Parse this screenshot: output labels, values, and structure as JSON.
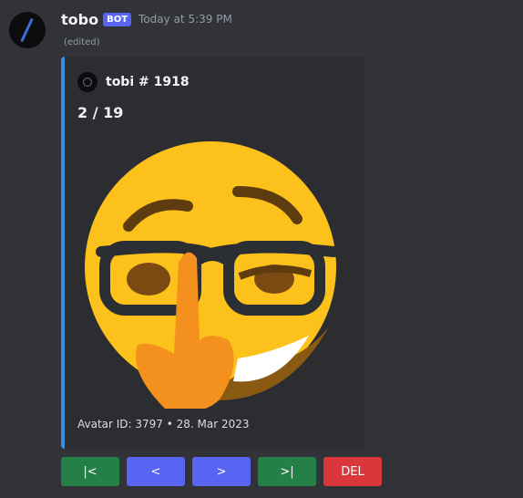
{
  "message": {
    "username": "tobo",
    "bot_badge": "BOT",
    "timestamp": "Today at 5:39 PM",
    "edited": "(edited)"
  },
  "embed": {
    "accent_color": "#3c8bdc",
    "author": "tobi # 1918",
    "title": "2 / 19",
    "image_icon": "thinking-glasses-emoji-icon",
    "footer": "Avatar ID: 3797 • 28. Mar 2023"
  },
  "buttons": [
    {
      "label": "|<",
      "style": "success"
    },
    {
      "label": "<",
      "style": "primary"
    },
    {
      "label": ">",
      "style": "primary"
    },
    {
      "label": ">|",
      "style": "success"
    },
    {
      "label": "DEL",
      "style": "danger"
    }
  ],
  "colors": {
    "background": "#313338",
    "embed_bg": "#2b2d31",
    "success": "#248046",
    "primary": "#5865f2",
    "danger": "#da373c"
  }
}
